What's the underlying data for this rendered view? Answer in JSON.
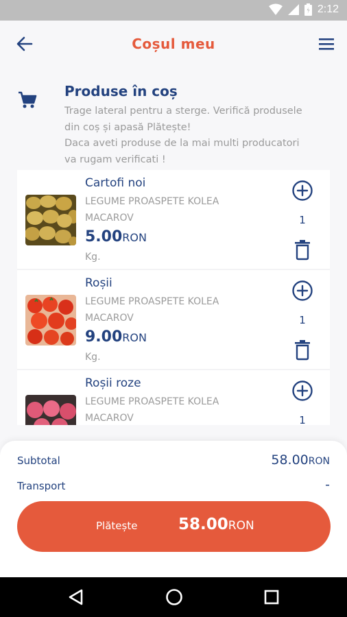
{
  "status_bar": {
    "time": "2:12",
    "icons": [
      "wifi-icon",
      "signal-icon",
      "battery-icon"
    ]
  },
  "app_bar": {
    "title": "Coșul meu",
    "back_icon": "arrow-left-icon",
    "menu_icon": "hamburger-menu-icon"
  },
  "info": {
    "icon": "shopping-cart-icon",
    "title": "Produse în coș",
    "line1": "Trage lateral pentru a sterge. Verifică produsele",
    "line2": "din coș și apasă Plătește!",
    "line3": "Daca aveti produse de la mai multi producatori",
    "line4": "va rugam verificati !"
  },
  "products": [
    {
      "name": "Cartofi noi",
      "producer_line1": "LEGUME PROASPETE KOLEA",
      "producer_line2": "MACAROV",
      "price": "5.00",
      "currency": "RON",
      "unit": "Kg.",
      "quantity": "1",
      "image": "potatoes"
    },
    {
      "name": "Roșii",
      "producer_line1": "LEGUME PROASPETE KOLEA",
      "producer_line2": "MACAROV",
      "price": "9.00",
      "currency": "RON",
      "unit": "Kg.",
      "quantity": "1",
      "image": "tomatoes"
    },
    {
      "name": "Roșii roze",
      "producer_line1": "LEGUME PROASPETE KOLEA",
      "producer_line2": "MACAROV",
      "price": "",
      "currency": "",
      "unit": "",
      "quantity": "1",
      "image": "pink-tomatoes"
    }
  ],
  "summary": {
    "subtotal_label": "Subtotal",
    "subtotal_value": "58.00",
    "subtotal_currency": "RON",
    "transport_label": "Transport",
    "transport_value": "-",
    "pay_label": "Plătește",
    "pay_total": "58.00",
    "pay_currency": "RON"
  },
  "colors": {
    "accent": "#e55a3c",
    "primary": "#23427f",
    "muted": "#9a9a9a",
    "background": "#f7f7f9"
  }
}
